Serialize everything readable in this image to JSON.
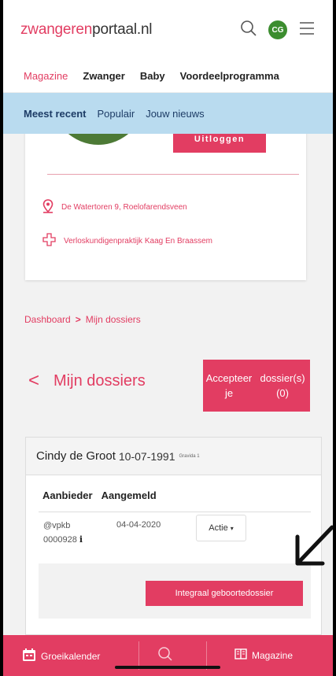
{
  "header": {
    "logo_part1": "zwangeren",
    "logo_part2": "portaal",
    "logo_part3": ".nl",
    "avatar_initials": "CG"
  },
  "main_nav": {
    "items": [
      "Magazine",
      "Zwanger",
      "Baby",
      "Voordeelprogramma"
    ]
  },
  "sub_nav": {
    "items": [
      "Meest recent",
      "Populair",
      "Jouw nieuws"
    ]
  },
  "profile": {
    "logout_label": "Uitloggen",
    "address": "De Watertoren 9, Roelofarendsveen",
    "practice": "Verloskundigenpraktijk Kaag En Braassem"
  },
  "breadcrumb": {
    "dashboard": "Dashboard",
    "separator": ">",
    "current": "Mijn dossiers"
  },
  "page": {
    "back_chevron": "<",
    "title": "Mijn dossiers",
    "accept_line1": "Accepteer je",
    "accept_line2": "dossier(s) (0)"
  },
  "dossier": {
    "name": "Cindy de Groot",
    "dob": "10-07-1991",
    "gravida": "Gravida 1",
    "col_aanbieder": "Aanbieder",
    "col_aangemeld": "Aangemeld",
    "aanbieder_line1": "@vpkb",
    "aanbieder_line2": "0000928",
    "info_icon": "i",
    "aangemeld": "04-04-2020",
    "actie_label": "Actie",
    "actie_caret": "▾",
    "integraal_label": "Integraal geboortedossier"
  },
  "bottom_bar": {
    "groeikalender": "Groeikalender",
    "magazine": "Magazine"
  },
  "colors": {
    "accent": "#e23d62",
    "subnav_bg": "#b9dbef",
    "avatar_green": "#3c8d2f"
  }
}
